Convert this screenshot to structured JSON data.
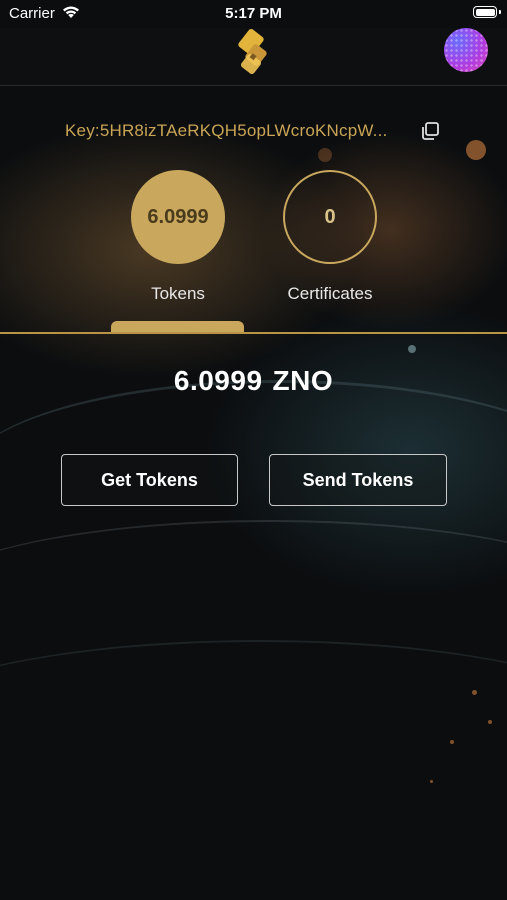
{
  "status_bar": {
    "carrier": "Carrier",
    "time": "5:17 PM"
  },
  "nav": {
    "logo_icon": "app-logo",
    "avatar_icon": "profile-avatar"
  },
  "wallet": {
    "key_label": "Key:5HR8izTAeRKQH5opLWcroKNcpW...",
    "copy_icon": "copy-icon",
    "tokens_value": "6.0999",
    "tokens_label": "Tokens",
    "certificates_value": "0",
    "certificates_label": "Certificates",
    "selected_tab": "Tokens"
  },
  "balance": {
    "amount": "6.0999",
    "unit": "ZNO"
  },
  "actions": {
    "get_tokens": "Get Tokens",
    "send_tokens": "Send Tokens"
  },
  "colors": {
    "accent_gold": "#c9a85e",
    "key_text": "#c9a455",
    "background": "#0b0d0f"
  }
}
